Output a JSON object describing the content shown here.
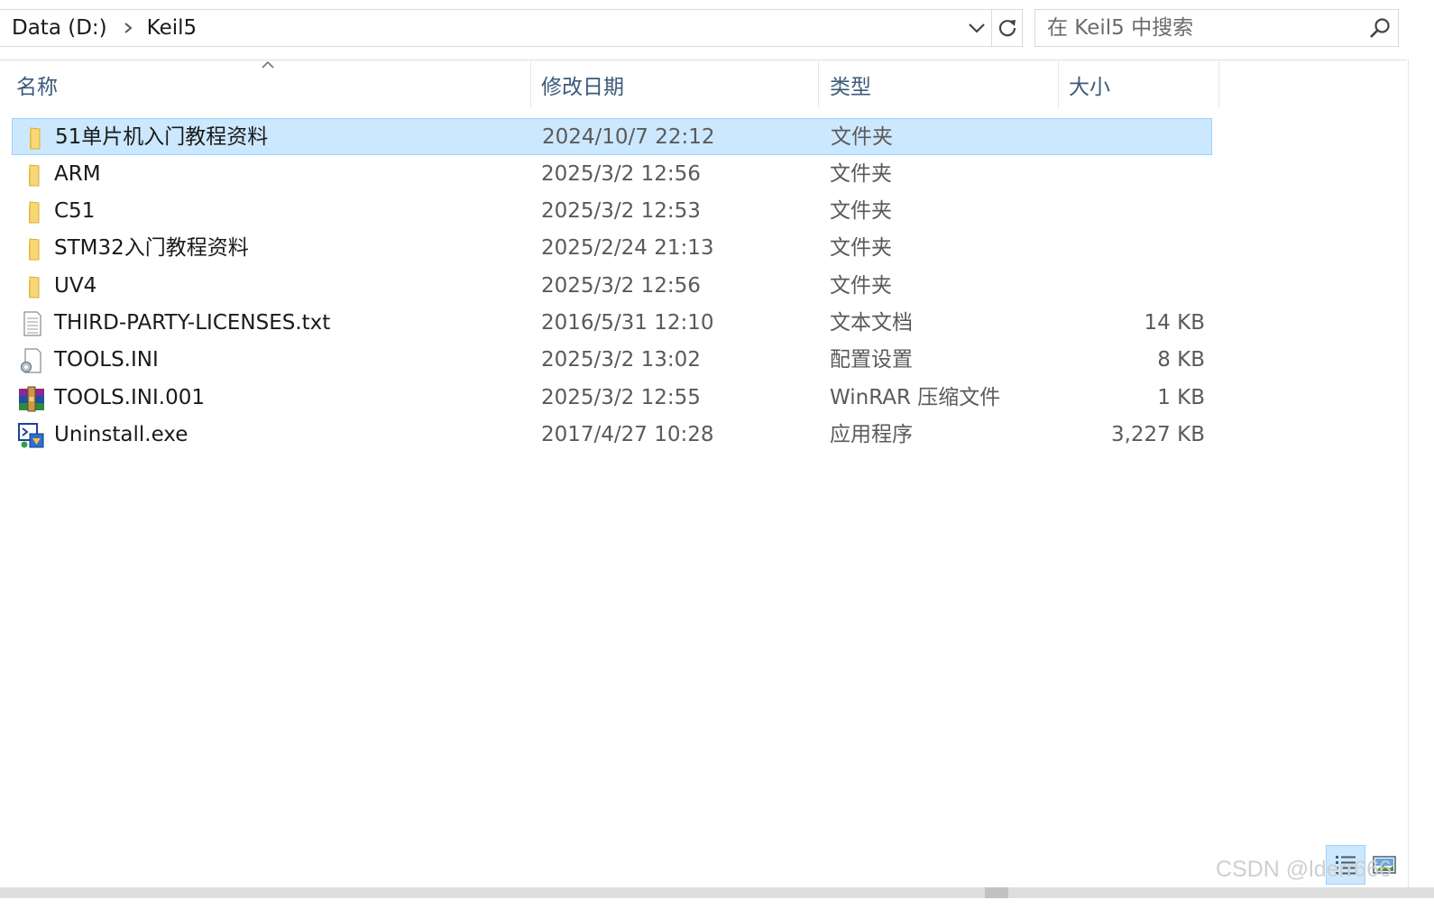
{
  "address_bar": {
    "breadcrumb": [
      "Data (D:)",
      "Keil5"
    ],
    "history_icon": "chevron-down-icon",
    "refresh_icon": "refresh-icon"
  },
  "search": {
    "placeholder": "在 Keil5 中搜索",
    "icon": "search-icon"
  },
  "columns": {
    "name": "名称",
    "date": "修改日期",
    "type": "类型",
    "size": "大小",
    "sorted_by": "name",
    "sort_direction": "ascending"
  },
  "files": [
    {
      "name": "51单片机入门教程资料",
      "date": "2024/10/7 22:12",
      "type": "文件夹",
      "size": "",
      "icon": "folder-icon",
      "selected": true
    },
    {
      "name": "ARM",
      "date": "2025/3/2 12:56",
      "type": "文件夹",
      "size": "",
      "icon": "folder-icon",
      "selected": false
    },
    {
      "name": "C51",
      "date": "2025/3/2 12:53",
      "type": "文件夹",
      "size": "",
      "icon": "folder-icon",
      "selected": false
    },
    {
      "name": "STM32入门教程资料",
      "date": "2025/2/24 21:13",
      "type": "文件夹",
      "size": "",
      "icon": "folder-icon",
      "selected": false
    },
    {
      "name": "UV4",
      "date": "2025/3/2 12:56",
      "type": "文件夹",
      "size": "",
      "icon": "folder-icon",
      "selected": false
    },
    {
      "name": "THIRD-PARTY-LICENSES.txt",
      "date": "2016/5/31 12:10",
      "type": "文本文档",
      "size": "14 KB",
      "icon": "text-file-icon",
      "selected": false
    },
    {
      "name": "TOOLS.INI",
      "date": "2025/3/2 13:02",
      "type": "配置设置",
      "size": "8 KB",
      "icon": "config-file-icon",
      "selected": false
    },
    {
      "name": "TOOLS.INI.001",
      "date": "2025/3/2 12:55",
      "type": "WinRAR 压缩文件",
      "size": "1 KB",
      "icon": "winrar-archive-icon",
      "selected": false
    },
    {
      "name": "Uninstall.exe",
      "date": "2017/4/27 10:28",
      "type": "应用程序",
      "size": "3,227 KB",
      "icon": "installer-app-icon",
      "selected": false
    }
  ],
  "view_modes": {
    "details_icon": "details-view-icon",
    "tiles_icon": "large-icons-view-icon",
    "active": "details"
  },
  "watermark": "CSDN @lderr666",
  "colors": {
    "selection_bg": "#cce8ff",
    "selection_border": "#99d1ff",
    "header_text": "#3b5a7a",
    "folder_yellow": "#f8d775"
  }
}
